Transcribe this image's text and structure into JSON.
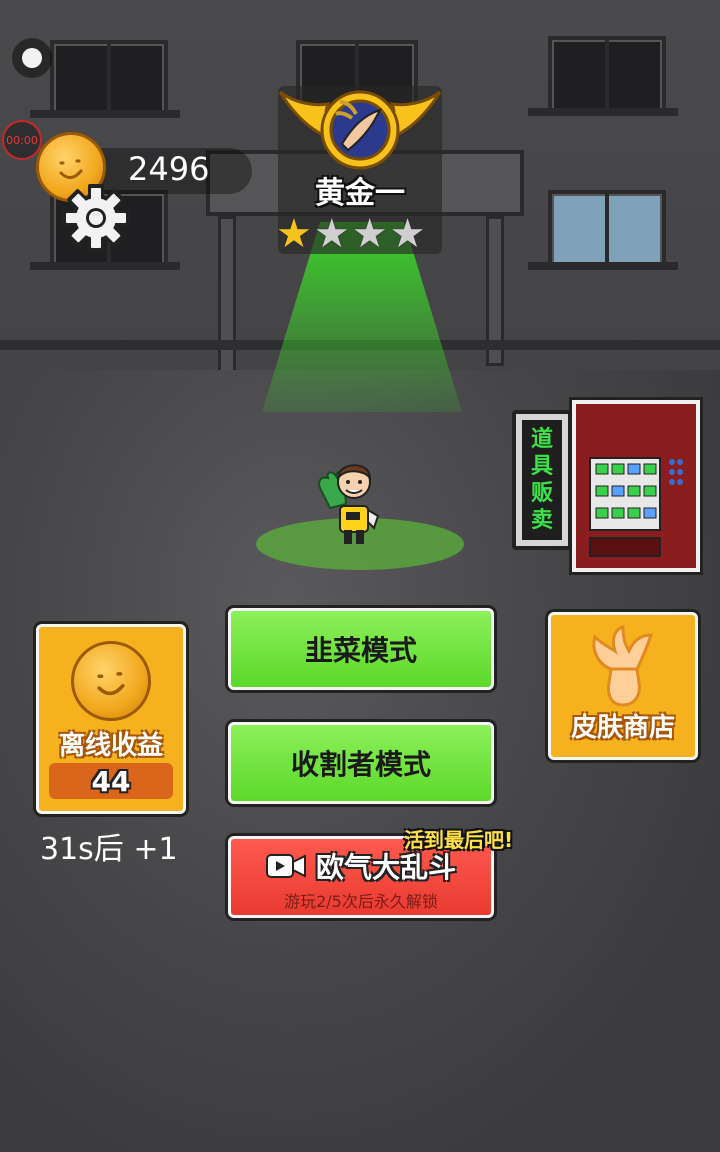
{
  "status": {
    "timer": "00:00"
  },
  "currency": {
    "coins": "2496",
    "icon": "coin-icon"
  },
  "rank": {
    "name": "黄金一",
    "stars_filled": 1,
    "stars_total": 4
  },
  "vending": {
    "sign": [
      "道",
      "具",
      "贩",
      "卖"
    ]
  },
  "modes": {
    "leek": "韭菜模式",
    "reaper": "收割者模式",
    "brawl_title": "欧气大乱斗",
    "brawl_sub": "游玩2/5次后永久解锁",
    "brawl_promo": "活到最后吧!"
  },
  "offline": {
    "label": "离线收益",
    "count": "44",
    "timer": "31s后 +1"
  },
  "skin_shop": {
    "label": "皮肤商店"
  },
  "colors": {
    "green_button": "#6ee23c",
    "red_button": "#f0453a",
    "gold_card": "#f5b21e",
    "beam": "#3cd22a"
  }
}
